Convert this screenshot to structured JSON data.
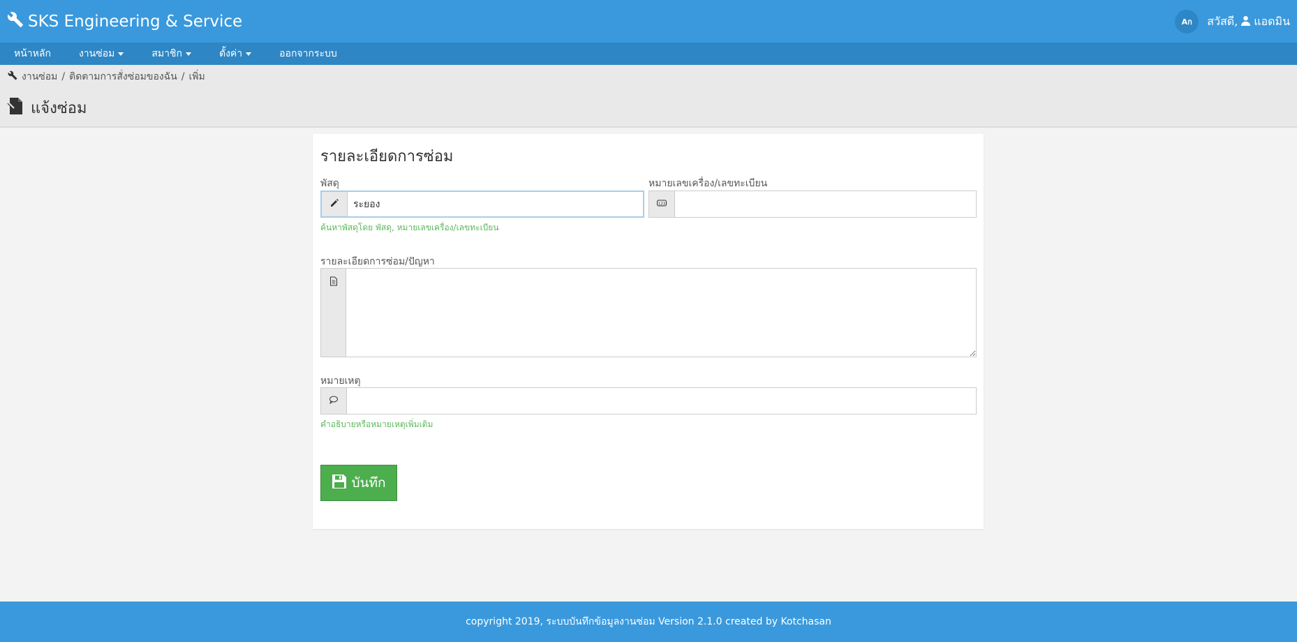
{
  "app": {
    "title": "SKS Engineering & Service"
  },
  "topbar": {
    "language_badge": "Aก",
    "greeting": "สวัสดี,",
    "username": "แอดมิน"
  },
  "nav": {
    "items": [
      {
        "label": "หน้าหลัก",
        "dropdown": false
      },
      {
        "label": "งานซ่อม",
        "dropdown": true
      },
      {
        "label": "สมาชิก",
        "dropdown": true
      },
      {
        "label": "ตั้งค่า",
        "dropdown": true
      },
      {
        "label": "ออกจากระบบ",
        "dropdown": false
      }
    ]
  },
  "breadcrumb": {
    "items": [
      "งานซ่อม",
      "ติดตามการสั่งซ่อมของฉัน",
      "เพิ่ม"
    ],
    "separator": "/"
  },
  "page": {
    "title": "แจ้งซ่อม"
  },
  "form": {
    "title": "รายละเอียดการซ่อม",
    "equipment": {
      "label": "พัสดุ",
      "value": "ระยอง",
      "help": "ค้นหาพัสดุโดย พัสดุ, หมายเลขเครื่อง/เลขทะเบียน"
    },
    "serial": {
      "label": "หมายเลขเครื่อง/เลขทะเบียน",
      "value": ""
    },
    "detail": {
      "label": "รายละเอียดการซ่อม/ปัญหา",
      "value": ""
    },
    "note": {
      "label": "หมายเหตุ",
      "value": "",
      "help": "คำอธิบายหรือหมายเหตุเพิ่มเติม"
    },
    "save_label": "บันทึก"
  },
  "footer": {
    "text": "copyright 2019, ระบบบันทึกข้อมูลงานซ่อม Version 2.1.0 created by Kotchasan"
  },
  "colors": {
    "primary": "#3a99dc",
    "nav": "#2f86c4",
    "success": "#4cae4c",
    "help_text": "#5cb85c"
  }
}
